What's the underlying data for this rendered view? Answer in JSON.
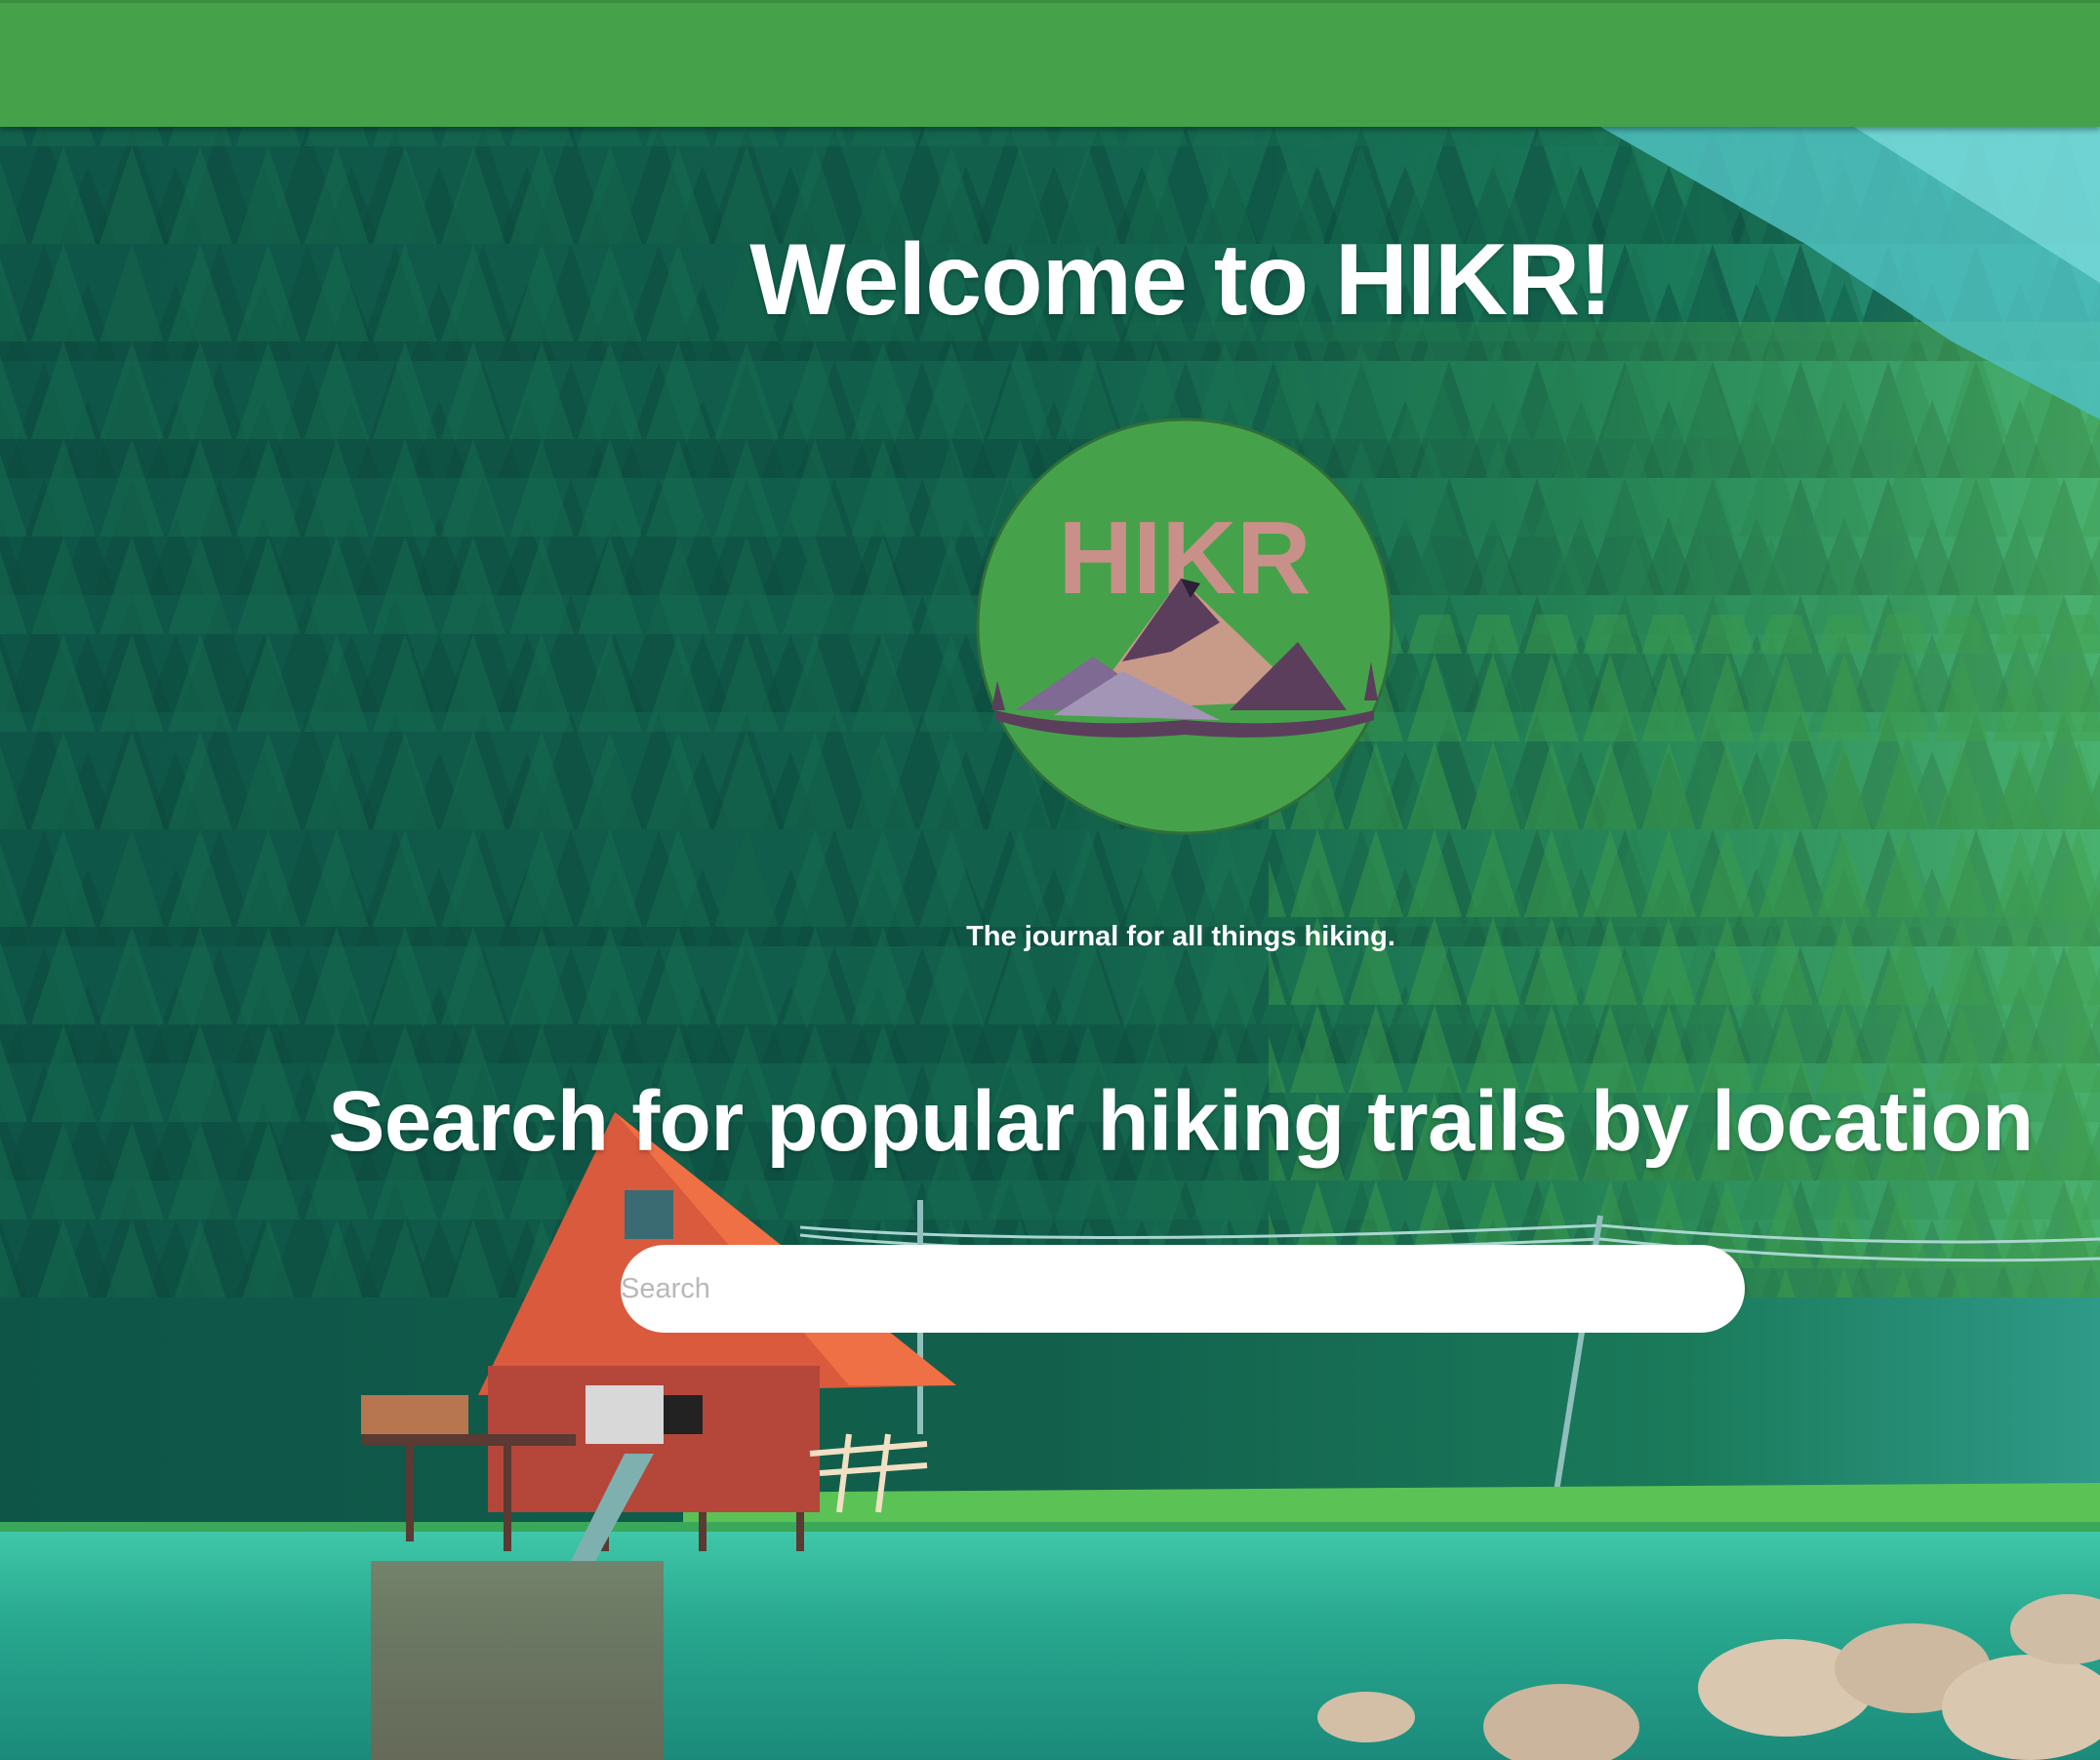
{
  "navbar": {
    "color": "#46a24a"
  },
  "hero": {
    "title": "Welcome to HIKR!",
    "tagline": "The journal for all things hiking.",
    "search_heading": "Search for popular hiking trails by location",
    "background": "forest-lake-cabin-illustration"
  },
  "logo": {
    "text": "HIKR",
    "circle_color": "#46a24a",
    "text_color": "#c9908a",
    "icon": "mountain-logo-icon"
  },
  "search": {
    "placeholder": "Search",
    "value": ""
  }
}
